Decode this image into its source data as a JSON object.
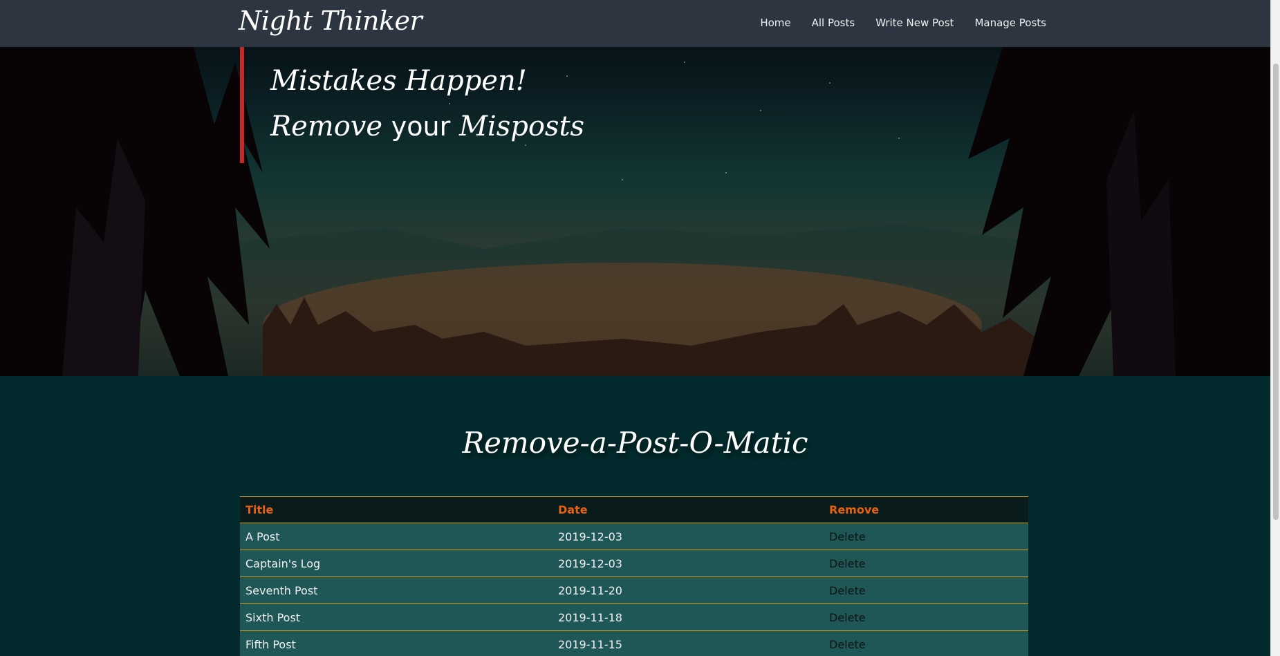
{
  "brand": "Night Thinker",
  "nav": {
    "home": "Home",
    "all_posts": "All Posts",
    "write_new_post": "Write New Post",
    "manage_posts": "Manage Posts"
  },
  "hero": {
    "line1": "Mistakes Happen!",
    "line2_part1": "Remove",
    "line2_part2": "your",
    "line2_part3": "Misposts",
    "accent_color": "#c62828"
  },
  "section_title": "Remove-a-Post-O-Matic",
  "table": {
    "headers": [
      "Title",
      "Date",
      "Remove"
    ],
    "rows": [
      {
        "title": "A Post",
        "date": "2019-12-03",
        "action": "Delete"
      },
      {
        "title": "Captain's Log",
        "date": "2019-12-03",
        "action": "Delete"
      },
      {
        "title": "Seventh Post",
        "date": "2019-11-20",
        "action": "Delete"
      },
      {
        "title": "Sixth Post",
        "date": "2019-11-18",
        "action": "Delete"
      },
      {
        "title": "Fifth Post",
        "date": "2019-11-15",
        "action": "Delete"
      }
    ]
  }
}
